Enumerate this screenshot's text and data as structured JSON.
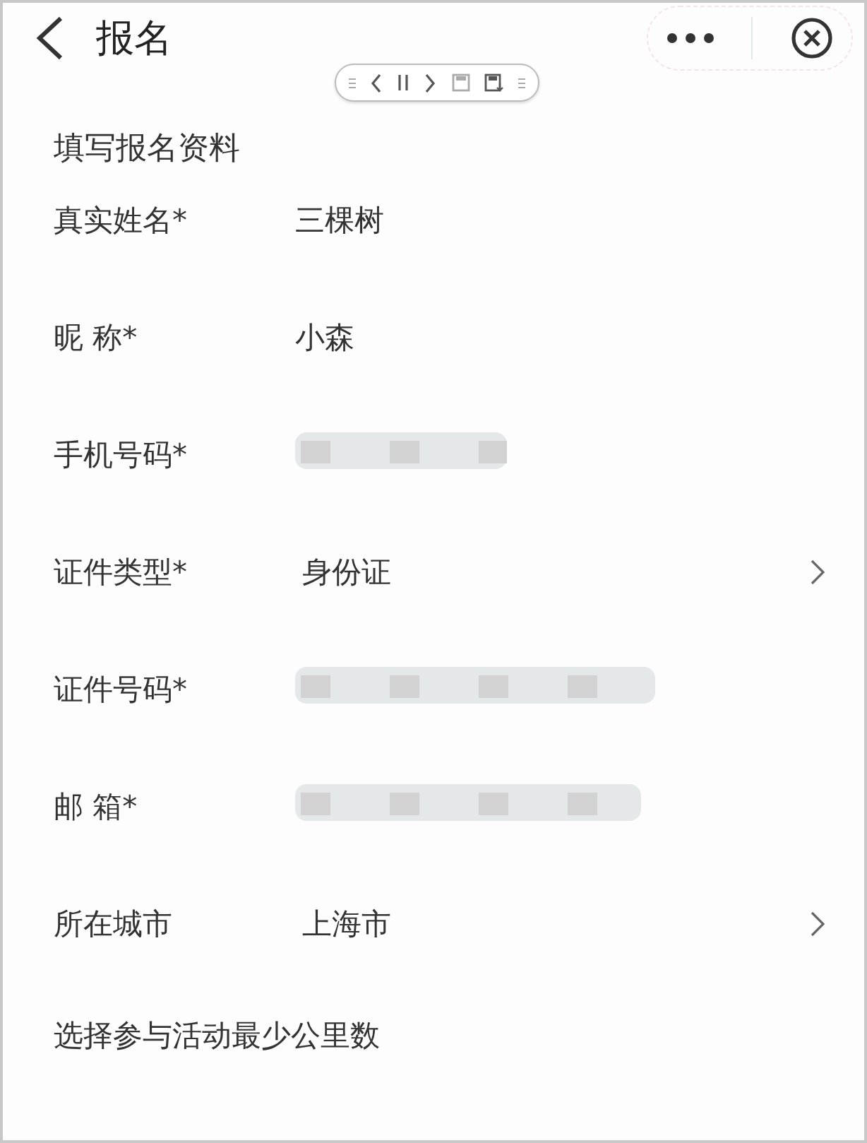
{
  "header": {
    "title": "报名"
  },
  "section_title": "填写报名资料",
  "fields": [
    {
      "label": "真实姓名*",
      "kind": "text",
      "value": "三棵树"
    },
    {
      "label": "昵 称*",
      "kind": "text",
      "value": "小森"
    },
    {
      "label": "手机号码*",
      "kind": "redacted"
    },
    {
      "label": "证件类型*",
      "kind": "select",
      "value": "身份证"
    },
    {
      "label": "证件号码*",
      "kind": "redacted"
    },
    {
      "label": "邮 箱*",
      "kind": "redacted"
    },
    {
      "label": "所在城市",
      "kind": "select",
      "value": "上海市"
    }
  ],
  "footer_label": "选择参与活动最少公里数"
}
